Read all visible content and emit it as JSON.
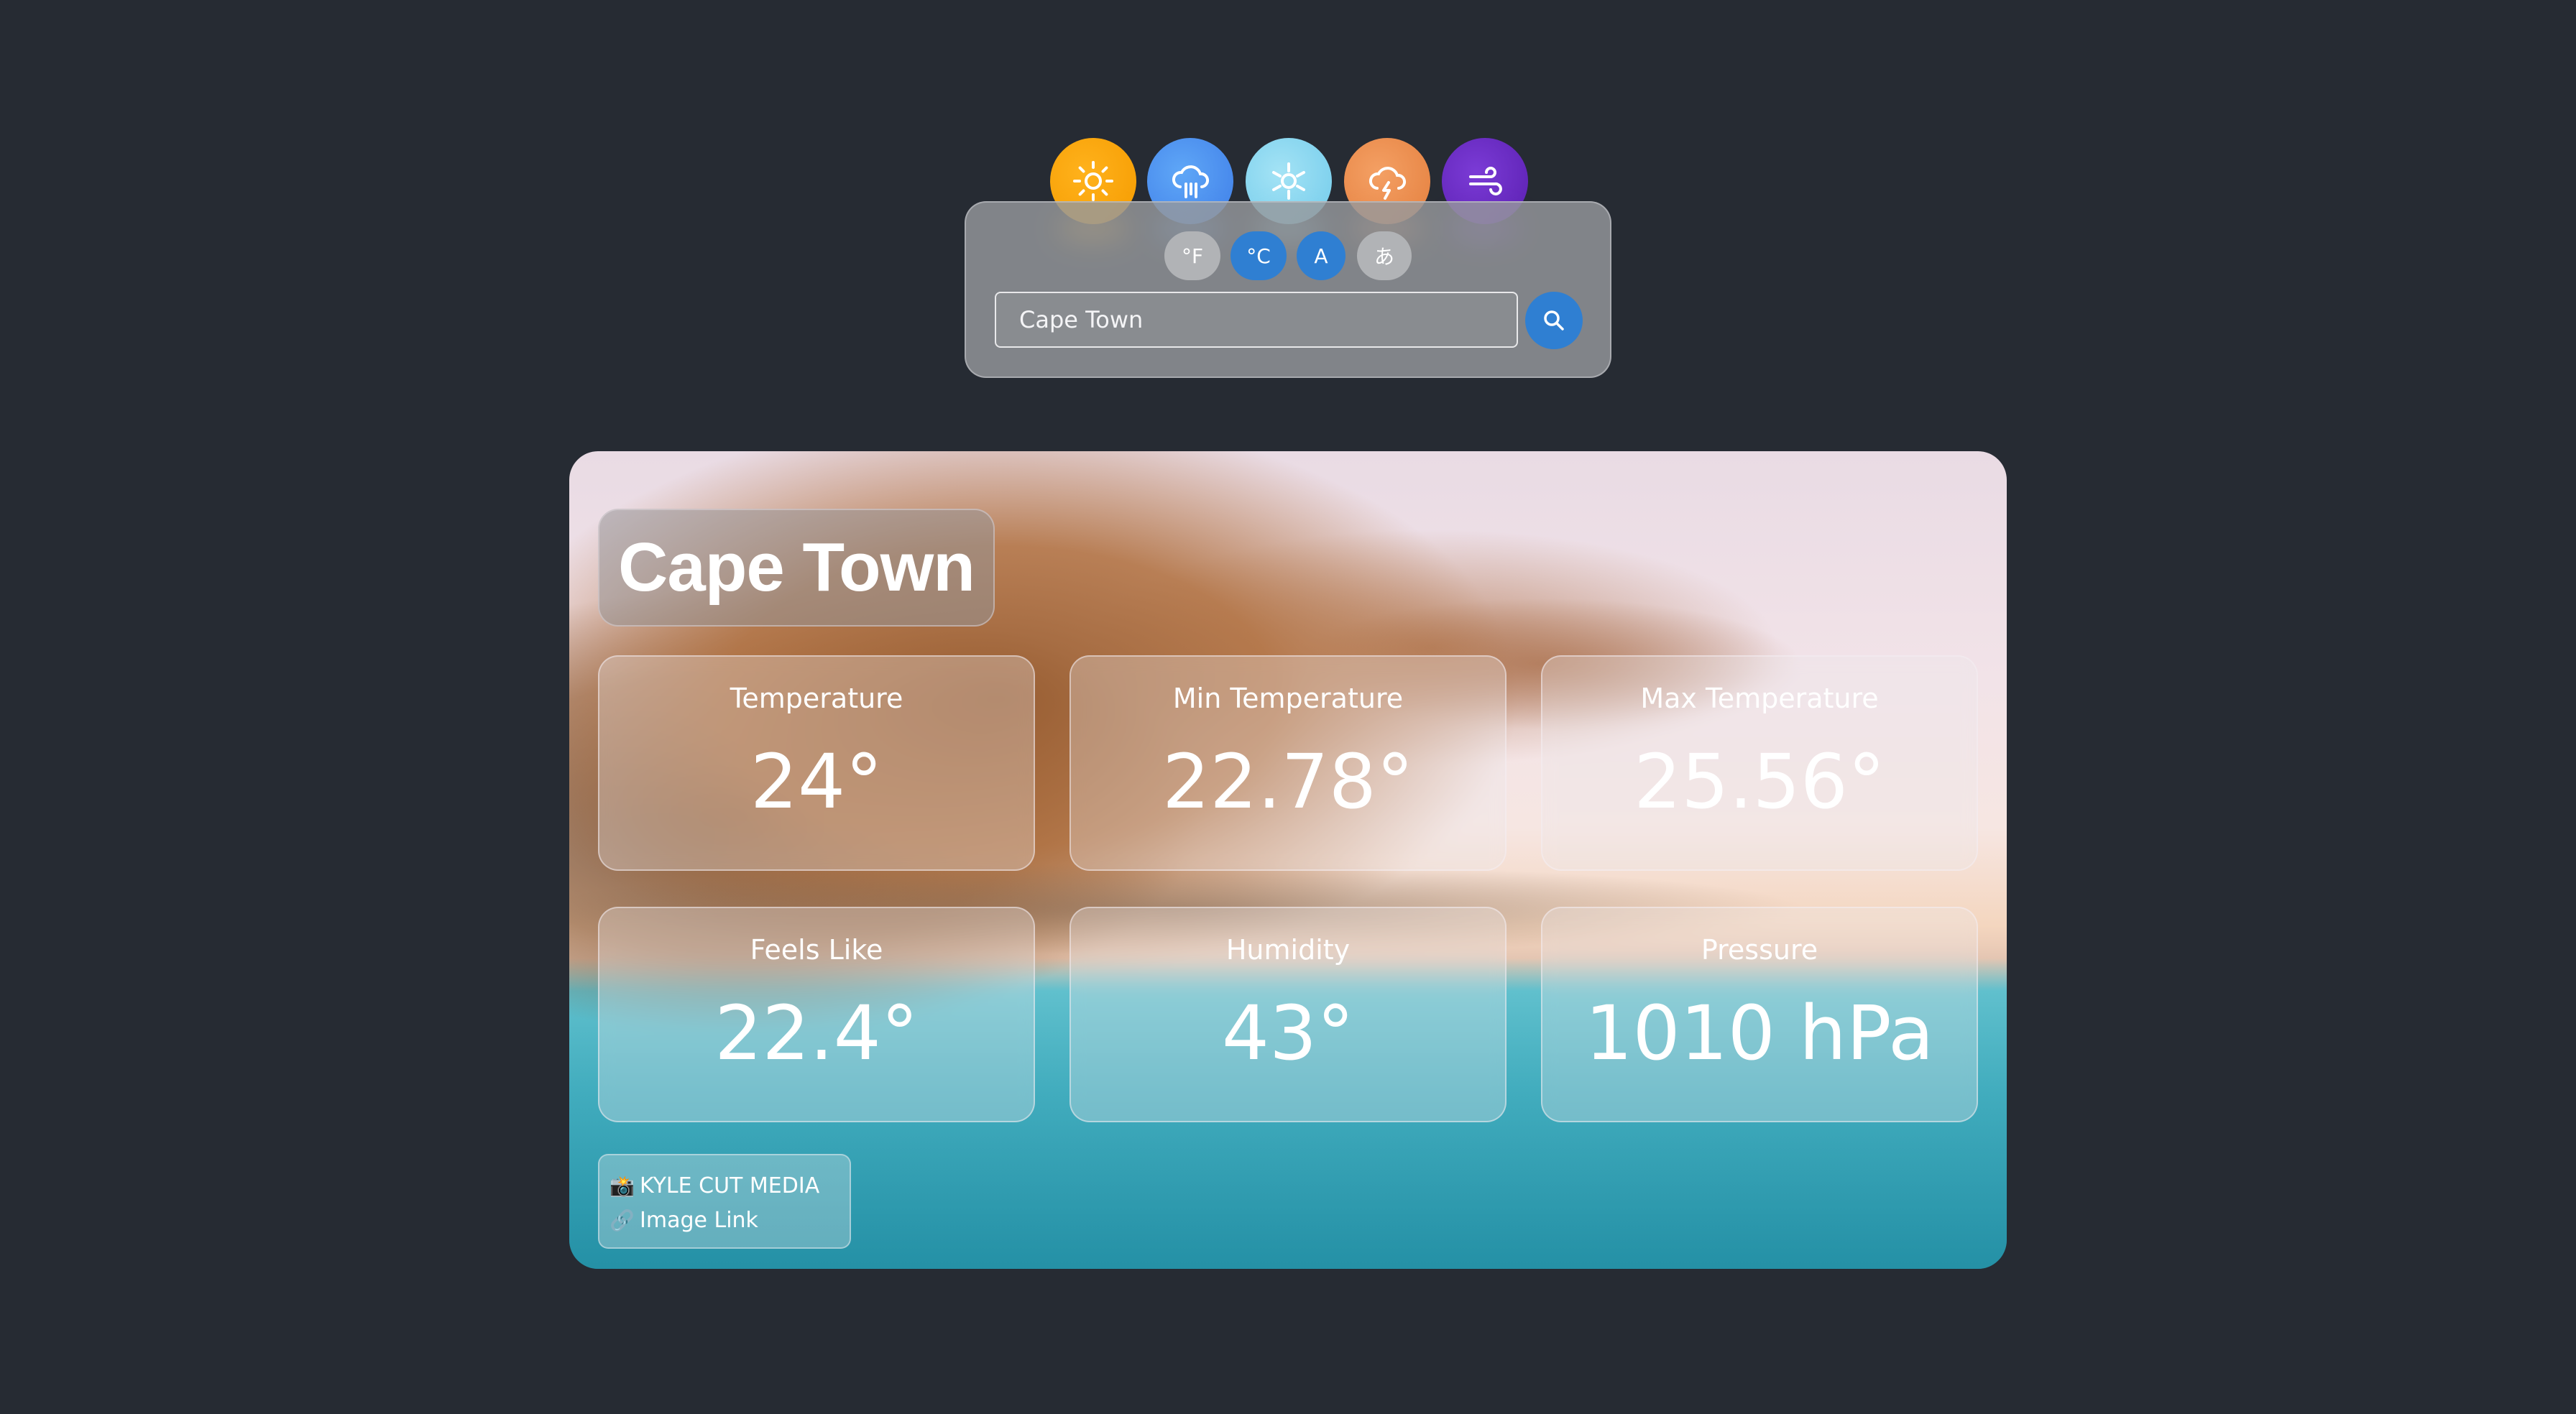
{
  "weather_icons": [
    {
      "name": "sun-icon",
      "color": "#f59b00"
    },
    {
      "name": "rain-icon",
      "color": "#3f7ee8"
    },
    {
      "name": "snow-icon",
      "color": "#72cbeb"
    },
    {
      "name": "thunderstorm-icon",
      "color": "#e47f3e"
    },
    {
      "name": "wind-icon",
      "color": "#5a1fb0"
    }
  ],
  "toggles": {
    "fahrenheit": "°F",
    "celsius": "°C",
    "latin_script": "A",
    "japanese_script": "あ"
  },
  "search": {
    "value": "Cape Town",
    "button_icon": "search-icon"
  },
  "weather": {
    "city": "Cape Town",
    "stats": [
      {
        "label": "Temperature",
        "value": "24°"
      },
      {
        "label": "Min Temperature",
        "value": "22.78°"
      },
      {
        "label": "Max Temperature",
        "value": "25.56°"
      },
      {
        "label": "Feels Like",
        "value": "22.4°"
      },
      {
        "label": "Humidity",
        "value": "43°"
      },
      {
        "label": "Pressure",
        "value": "1010 hPa"
      }
    ]
  },
  "credit": {
    "camera_glyph": "📸",
    "photographer": "KYLE CUT MEDIA",
    "link_glyph": "🔗",
    "link_text": "Image Link"
  },
  "colors": {
    "page_background": "#262b33",
    "accent_blue": "#2f7fd2",
    "toggle_inactive": "#b1b3b6"
  }
}
